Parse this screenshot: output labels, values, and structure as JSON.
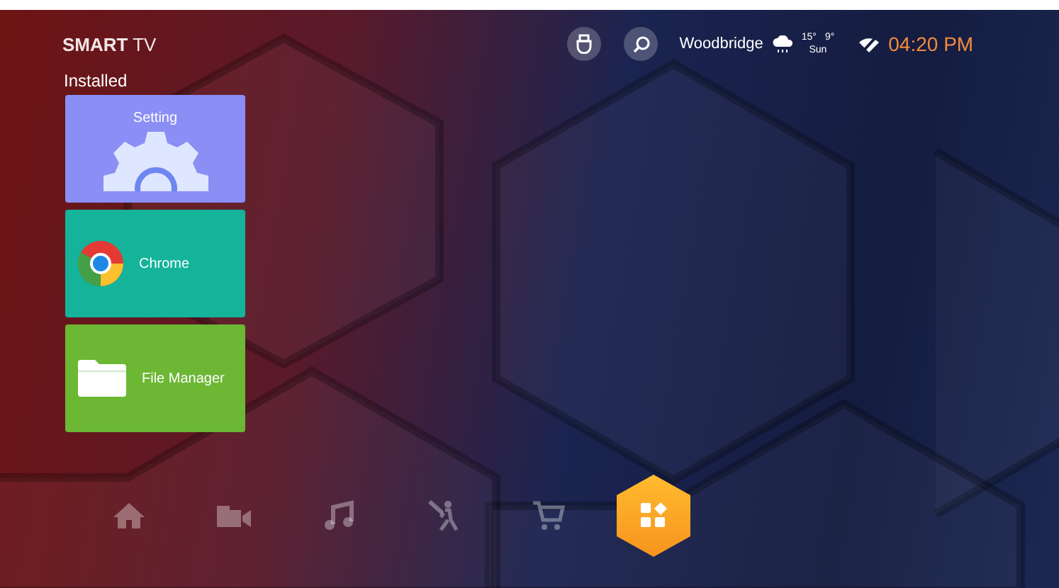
{
  "brand": "**SMART** TV",
  "toolbar": [
    {
      "kind": "input"
    },
    {
      "kind": "search"
    }
  ],
  "weather": {
    "city": "Woodbridge",
    "high": "15°",
    "low": "9°",
    "day": "Sun"
  },
  "clock": "04:20 PM",
  "section_title": "Installed",
  "apps": [
    {
      "kind": "setting",
      "label": "Setting",
      "color": "#8a8ef5"
    },
    {
      "kind": "chrome",
      "label": "Chrome",
      "color": "#14b39a"
    },
    {
      "kind": "files",
      "label": "File Manager",
      "color": "#6cb733"
    }
  ],
  "nav": [
    {
      "kind": "home",
      "selected": false
    },
    {
      "kind": "video",
      "selected": false
    },
    {
      "kind": "music",
      "selected": false
    },
    {
      "kind": "sports",
      "selected": false
    },
    {
      "kind": "shop",
      "selected": false
    },
    {
      "kind": "apps",
      "selected": true
    }
  ]
}
